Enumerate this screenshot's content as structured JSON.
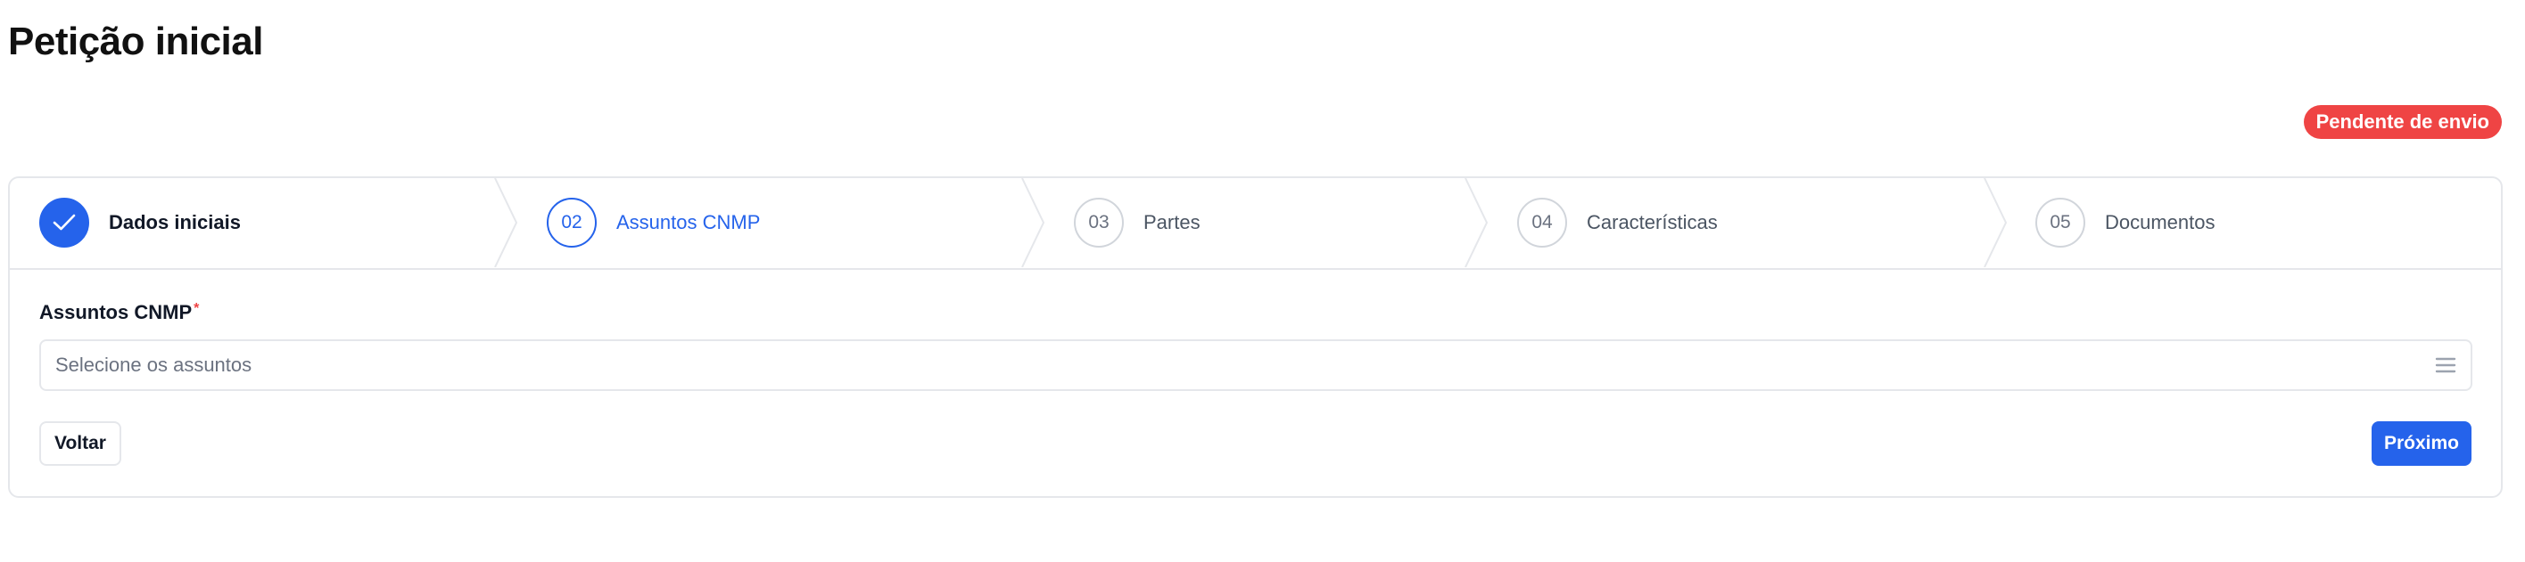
{
  "page": {
    "title": "Petição inicial"
  },
  "status": {
    "label": "Pendente de envio",
    "color": "#ef4444"
  },
  "accent_color": "#2563eb",
  "steps": [
    {
      "number": "",
      "label": "Dados iniciais",
      "state": "done",
      "icon": "check-icon"
    },
    {
      "number": "02",
      "label": "Assuntos CNMP",
      "state": "active"
    },
    {
      "number": "03",
      "label": "Partes",
      "state": "pending"
    },
    {
      "number": "04",
      "label": "Características",
      "state": "pending"
    },
    {
      "number": "05",
      "label": "Documentos",
      "state": "pending"
    }
  ],
  "form": {
    "assuntos": {
      "label": "Assuntos CNMP",
      "required_mark": "*",
      "placeholder": "Selecione os assuntos",
      "icon": "list-icon"
    }
  },
  "actions": {
    "back_label": "Voltar",
    "next_label": "Próximo"
  }
}
